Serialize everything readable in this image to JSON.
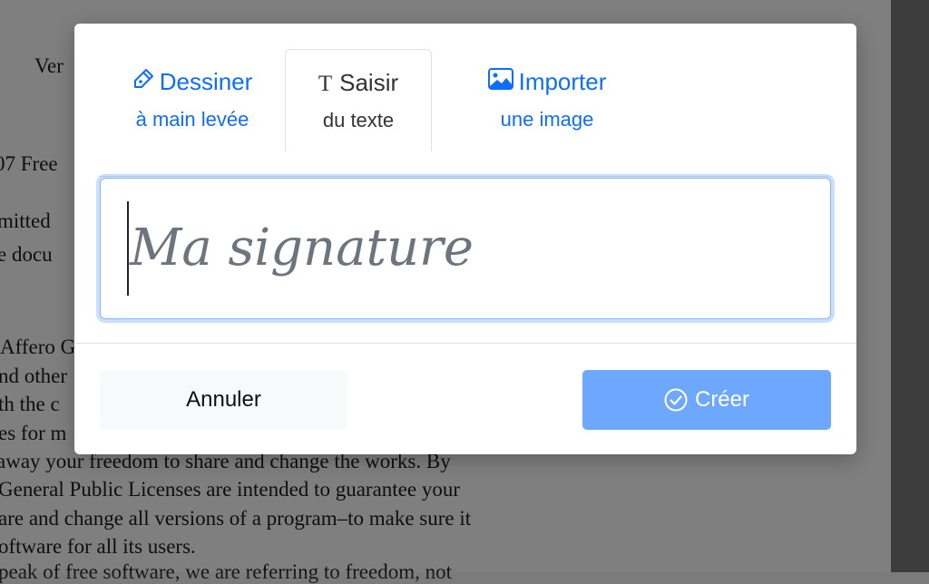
{
  "background_document": {
    "lines": [
      "Ver",
      "07 Free",
      "mitted",
      "e docu",
      "Affero G",
      "nd other",
      "th the c",
      "es for m",
      " away your freedom to share and change the works.  By",
      "General Public Licenses are intended to guarantee your",
      "are and change all versions of a program–to make sure it",
      "oftware for all its users.",
      "peak of free software, we are referring to freedom, not"
    ]
  },
  "modal": {
    "tabs": {
      "draw": {
        "title": "Dessiner",
        "subtitle": "à main levée",
        "icon": "pen-icon"
      },
      "type": {
        "glyph": "T",
        "title": "Saisir",
        "subtitle": "du texte",
        "active": true
      },
      "import": {
        "title": "Importer",
        "subtitle": "une image",
        "icon": "image-icon"
      }
    },
    "signature_field": {
      "placeholder": "Ma signature",
      "value": ""
    },
    "buttons": {
      "cancel_label": "Annuler",
      "create_label": "Créer",
      "create_icon": "check-circle-icon"
    }
  },
  "colors": {
    "accent": "#0d6efd",
    "create_button": "#6ea8fe",
    "field_focus": "#86b7fe",
    "placeholder": "#6c757d"
  }
}
